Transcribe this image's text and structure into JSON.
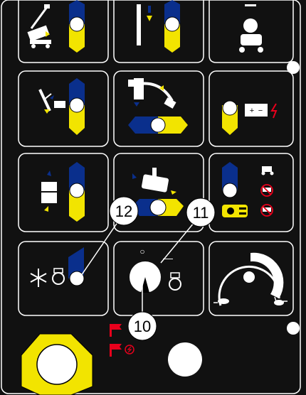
{
  "colors": {
    "panel_bg": "#111111",
    "button_border": "#ffffff",
    "blue": "#0a2f8c",
    "yellow": "#f2e400",
    "red": "#e8001c",
    "white": "#ffffff",
    "black": "#000000"
  },
  "callouts": [
    {
      "id": "12",
      "label": "12"
    },
    {
      "id": "11",
      "label": "11"
    },
    {
      "id": "10",
      "label": "10"
    }
  ],
  "key_switch": {
    "off_mark": "○",
    "on_mark": "—"
  },
  "battery": {
    "plus": "+",
    "minus": "−"
  }
}
